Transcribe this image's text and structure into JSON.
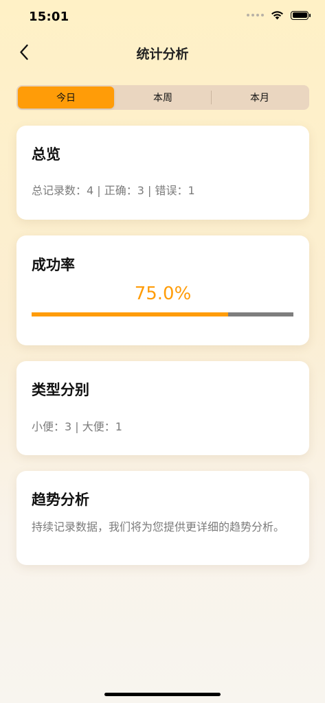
{
  "status_bar": {
    "time": "15:01",
    "icons": [
      "signal-dots-icon",
      "wifi-icon",
      "battery-icon"
    ]
  },
  "nav": {
    "title": "统计分析",
    "back_icon": "chevron-left-icon"
  },
  "tabs": [
    {
      "label": "今日",
      "active": true
    },
    {
      "label": "本周",
      "active": false
    },
    {
      "label": "本月",
      "active": false
    }
  ],
  "overview": {
    "title": "总览",
    "summary": "总记录数：4 | 正确：3 | 错误：1"
  },
  "success_rate": {
    "title": "成功率",
    "value_text": "75.0%",
    "fraction": 0.75
  },
  "type_breakdown": {
    "title": "类型分别",
    "summary": "小便：3 | 大便：1"
  },
  "trend": {
    "title": "趋势分析",
    "message": "持续记录数据，我们将为您提供更详细的趋势分析。"
  },
  "colors": {
    "accent": "#ff9c08",
    "segment_bg": "#ead6c0",
    "progress_track": "#7e7e7e",
    "muted_text": "#7b7b7b"
  }
}
